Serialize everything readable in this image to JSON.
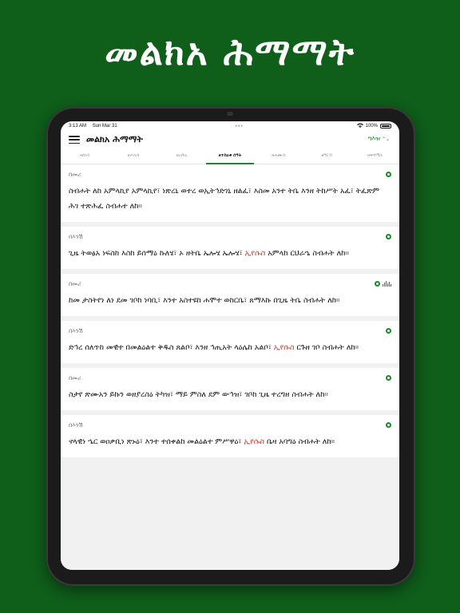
{
  "promo": {
    "title": "መልክአ ሕማማት"
  },
  "status_bar": {
    "time": "3:13 AM",
    "date": "Sun Mar 31",
    "battery": "100%"
  },
  "nav": {
    "title": "መልክአ ሕማማት",
    "language": "ግእዝ"
  },
  "tabs": [
    {
      "label": "ዘሰኑይ",
      "active": false
    },
    {
      "label": "ዘሠሉስ",
      "active": false
    },
    {
      "label": "ዘረቡዕ",
      "active": false
    },
    {
      "label": "ዘተስዐቱ ሰዓት",
      "active": true
    },
    {
      "label": "ዘሐሙስ",
      "active": false
    },
    {
      "label": "ዘዓርብ",
      "active": false
    },
    {
      "label": "ዘቀዳሚት",
      "active": false
    }
  ],
  "cards": [
    {
      "role": "በመሪ",
      "has_audio": false,
      "before": "ስብሐት ለከ አምላኪየ አምላኪየ፣ ነጽረኒ ወተረ ወኢትኅድገኒ ዘልፈ፣ እስመ አንተ ትቤ እንዘ ትከሥት አፈ፣ ትፈጽም ሕገ ተጽሕፈ ስብሐተ ለከ።",
      "highlight": "",
      "after": ""
    },
    {
      "role": "በእንሽ",
      "has_audio": false,
      "before": "ጊዜ ትወፅአ ነፍስከ እስከ ይሰማዕ ኩለሄ፣ ኦ ዘትቤ ኤሎሄ ኤሎሄ፣ ",
      "highlight": "ኢየሱስ",
      "after": " አምላከ ርህራኄ ስብሐት ለከ።"
    },
    {
      "role": "በመሪ",
      "has_audio": true,
      "before": "ከመ ታስትየነ ለነ ደመ ገቦከ ነባቢ፣ እንተ አስተዩከ ሐሞተ ወከርቤ፣ ጸማእኩ በጊዜ ትቤ ስብሐት ለከ።",
      "highlight": "",
      "after": ""
    },
    {
      "role": "በእንሽ",
      "has_audio": false,
      "before": "ድኅረ ሰለጥከ መዊተ በመልዕልተ ቅዱስ ጸልቦ፣ እንዘ ኅጢአት ላዕሌከ አልቦ፣ ",
      "highlight": "ኢየሱስ",
      "after": " ርጉዘ ገቦ ስብሐት ለከ።"
    },
    {
      "role": "በመሪ",
      "has_audio": false,
      "before": "ስታየ ጽሙአን ይኩን ወዘያረስዕ ትካዝ፣ ማይ ምስለ ደም ውኅዝ፣ ገቦከ ጊዜ ተረግዘ ስብሐት ለከ።",
      "highlight": "",
      "after": ""
    },
    {
      "role": "በእንሽ",
      "has_audio": false,
      "before": "ኖላዊነ ኄር ወዐቃቢነ ጽኑዕ፣ እንተ ተሰቀልከ መልዕልተ ምሥዋዕ፣ ",
      "highlight": "ኢየሱስ",
      "after": " ቤዛ አባግዕ ስብሐት ለከ።"
    }
  ]
}
